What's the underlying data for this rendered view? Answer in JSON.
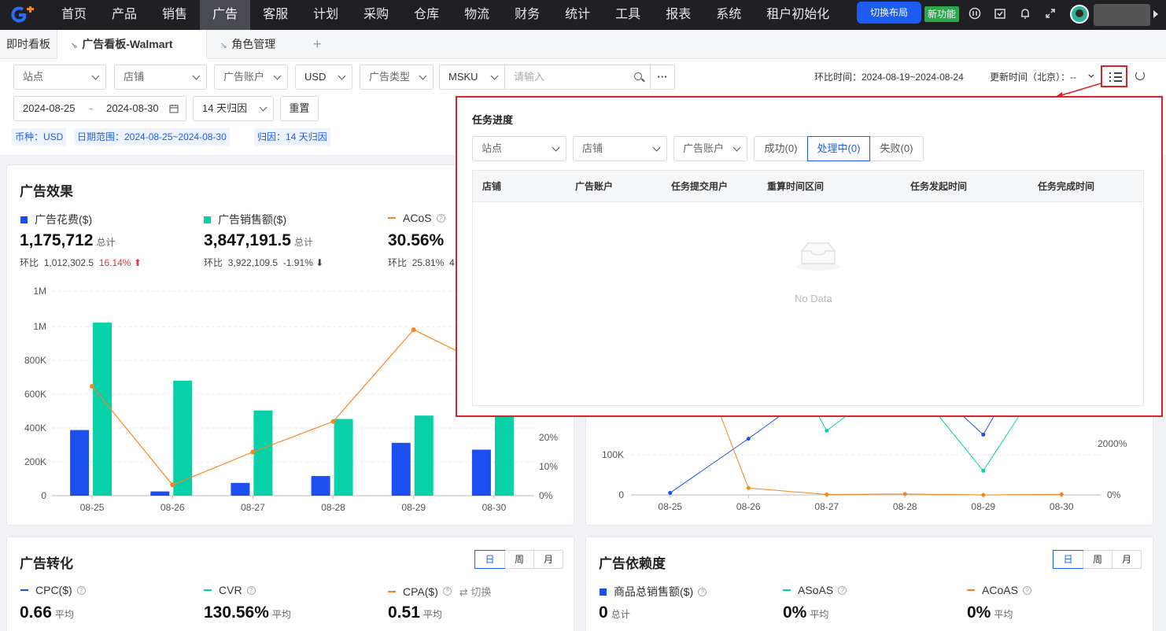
{
  "nav": {
    "items": [
      "首页",
      "产品",
      "销售",
      "广告",
      "客服",
      "计划",
      "采购",
      "仓库",
      "物流",
      "财务",
      "统计",
      "工具",
      "报表",
      "系统",
      "租户初始化"
    ],
    "active_index": 3,
    "switch_layout": "切换布局",
    "new_feature": "新功能"
  },
  "tabs": {
    "t0": "即时看板",
    "t1": "广告看板-Walmart",
    "t2": "角色管理",
    "plus": "+"
  },
  "filters": {
    "site": "站点",
    "store": "店铺",
    "account": "广告账户",
    "currency": "USD",
    "ad_type": "广告类型",
    "msku": "MSKU",
    "search_placeholder": "请输入",
    "more": "···",
    "date_start": "2024-08-25",
    "date_sep": "-",
    "date_end": "2024-08-30",
    "attribution": "14 天归因",
    "reset": "重置",
    "compare_label": "环比时间：2024-08-19~2024-08-24",
    "update_label": "更新时间（北京）：--",
    "tag_currency": "币种：USD",
    "tag_range": "日期范围：2024-08-25~2024-08-30",
    "tag_attr": "归因：14 天归因"
  },
  "effect": {
    "title": "广告效果",
    "m1": {
      "label": "广告花费($)",
      "value": "1,175,712",
      "unit": "总计",
      "cmp_label": "环比",
      "cmp_value": "1,012,302.5",
      "change": "16.14%",
      "color": "#1c4ff0"
    },
    "m2": {
      "label": "广告销售额($)",
      "value": "3,847,191.5",
      "unit": "总计",
      "cmp_label": "环比",
      "cmp_value": "3,922,109.5",
      "change": "-1.91%",
      "color": "#07d1a8"
    },
    "m3": {
      "label": "ACoS",
      "value": "30.56%",
      "cmp_label": "环比",
      "cmp_value": "25.81%",
      "change": "4",
      "color": "#f5861f"
    }
  },
  "chart_data": [
    {
      "type": "bar",
      "categories": [
        "08-25",
        "08-26",
        "08-27",
        "08-28",
        "08-29",
        "08-30"
      ],
      "series": [
        {
          "name": "广告花费($)",
          "type": "bar",
          "values": [
            385000,
            25000,
            75000,
            115000,
            310000,
            270000
          ],
          "color": "#1c4ff0"
        },
        {
          "name": "广告销售额($)",
          "type": "bar",
          "values": [
            1015000,
            675000,
            500000,
            450000,
            470000,
            470000
          ],
          "color": "#07d1a8"
        },
        {
          "name": "ACoS",
          "type": "line",
          "axis": "right",
          "values": [
            null,
            3.7,
            15,
            25.5,
            57,
            null
          ],
          "color": "#f5861f"
        }
      ],
      "y_ticks": [
        "0",
        "200K",
        "400K",
        "600K",
        "800K",
        "1M",
        "1M"
      ],
      "y2_ticks": [
        "0%",
        "10%",
        "20%"
      ],
      "ylim": [
        0,
        1200000
      ]
    },
    {
      "type": "line",
      "categories": [
        "08-25",
        "08-26",
        "08-27",
        "08-28",
        "08-29",
        "08-30"
      ],
      "y_ticks": [
        "0",
        "100K"
      ],
      "y2_ticks": [
        "0%",
        "2000%"
      ],
      "series": [
        {
          "type": "line",
          "values": [
            5000,
            140000,
            null,
            null,
            150000,
            null
          ],
          "color": "#1c4ff0"
        },
        {
          "type": "line",
          "values": [
            null,
            null,
            160000,
            null,
            60000,
            null
          ],
          "color": "#07d1a8"
        },
        {
          "type": "line",
          "axis": "right",
          "values": [
            null,
            270,
            15,
            35,
            0,
            20
          ],
          "color": "#f5861f"
        }
      ]
    }
  ],
  "conversion": {
    "title": "广告转化",
    "periods": [
      "日",
      "周",
      "月"
    ],
    "m1": {
      "label": "CPC($)",
      "value": "0.66",
      "unit": "平均"
    },
    "m2": {
      "label": "CVR",
      "value": "130.56%",
      "unit": "平均"
    },
    "m3": {
      "label": "CPA($)",
      "value": "0.51",
      "unit": "平均",
      "switch": "切换"
    }
  },
  "dependency": {
    "title": "广告依赖度",
    "periods": [
      "日",
      "周",
      "月"
    ],
    "m1": {
      "label": "商品总销售额($)",
      "value": "0",
      "unit": "总计"
    },
    "m2": {
      "label": "ASoAS",
      "value": "0%",
      "unit": "平均"
    },
    "m3": {
      "label": "ACoAS",
      "value": "0%",
      "unit": "平均"
    }
  },
  "task_panel": {
    "title": "任务进度",
    "site": "站点",
    "store": "店铺",
    "account": "广告账户",
    "status": [
      "成功(0)",
      "处理中(0)",
      "失败(0)"
    ],
    "columns": [
      "店铺",
      "广告账户",
      "任务提交用户",
      "重算时间区间",
      "任务发起时间",
      "任务完成时间"
    ],
    "empty": "No Data"
  }
}
